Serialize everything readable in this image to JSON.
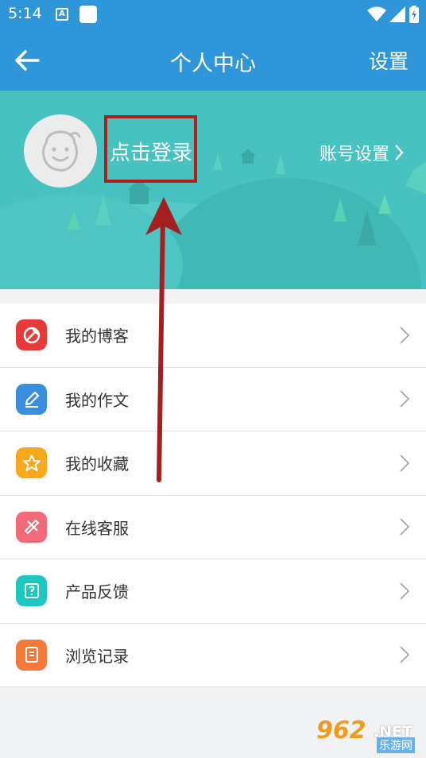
{
  "status_bar": {
    "time": "5:14",
    "a_badge": "A"
  },
  "app_bar": {
    "title": "个人中心",
    "settings_label": "设置"
  },
  "profile": {
    "login_label": "点击登录",
    "account_settings_label": "账号设置"
  },
  "menu": [
    {
      "label": "我的博客",
      "icon": "blog-icon",
      "color": "#e53b3b"
    },
    {
      "label": "我的作文",
      "icon": "pencil-icon",
      "color": "#3a8ee0"
    },
    {
      "label": "我的收藏",
      "icon": "star-icon",
      "color": "#f7a81c"
    },
    {
      "label": "在线客服",
      "icon": "customer-service-icon",
      "color": "#f06a7a"
    },
    {
      "label": "产品反馈",
      "icon": "feedback-icon",
      "color": "#1cc9c0"
    },
    {
      "label": "浏览记录",
      "icon": "history-icon",
      "color": "#f47a3c"
    }
  ],
  "watermark": {
    "number": "962",
    "suffix": ".NET",
    "site": "乐游网"
  },
  "colors": {
    "primary": "#2f97d9",
    "header_bg": "#47c2c1",
    "highlight": "#b01e1e"
  }
}
